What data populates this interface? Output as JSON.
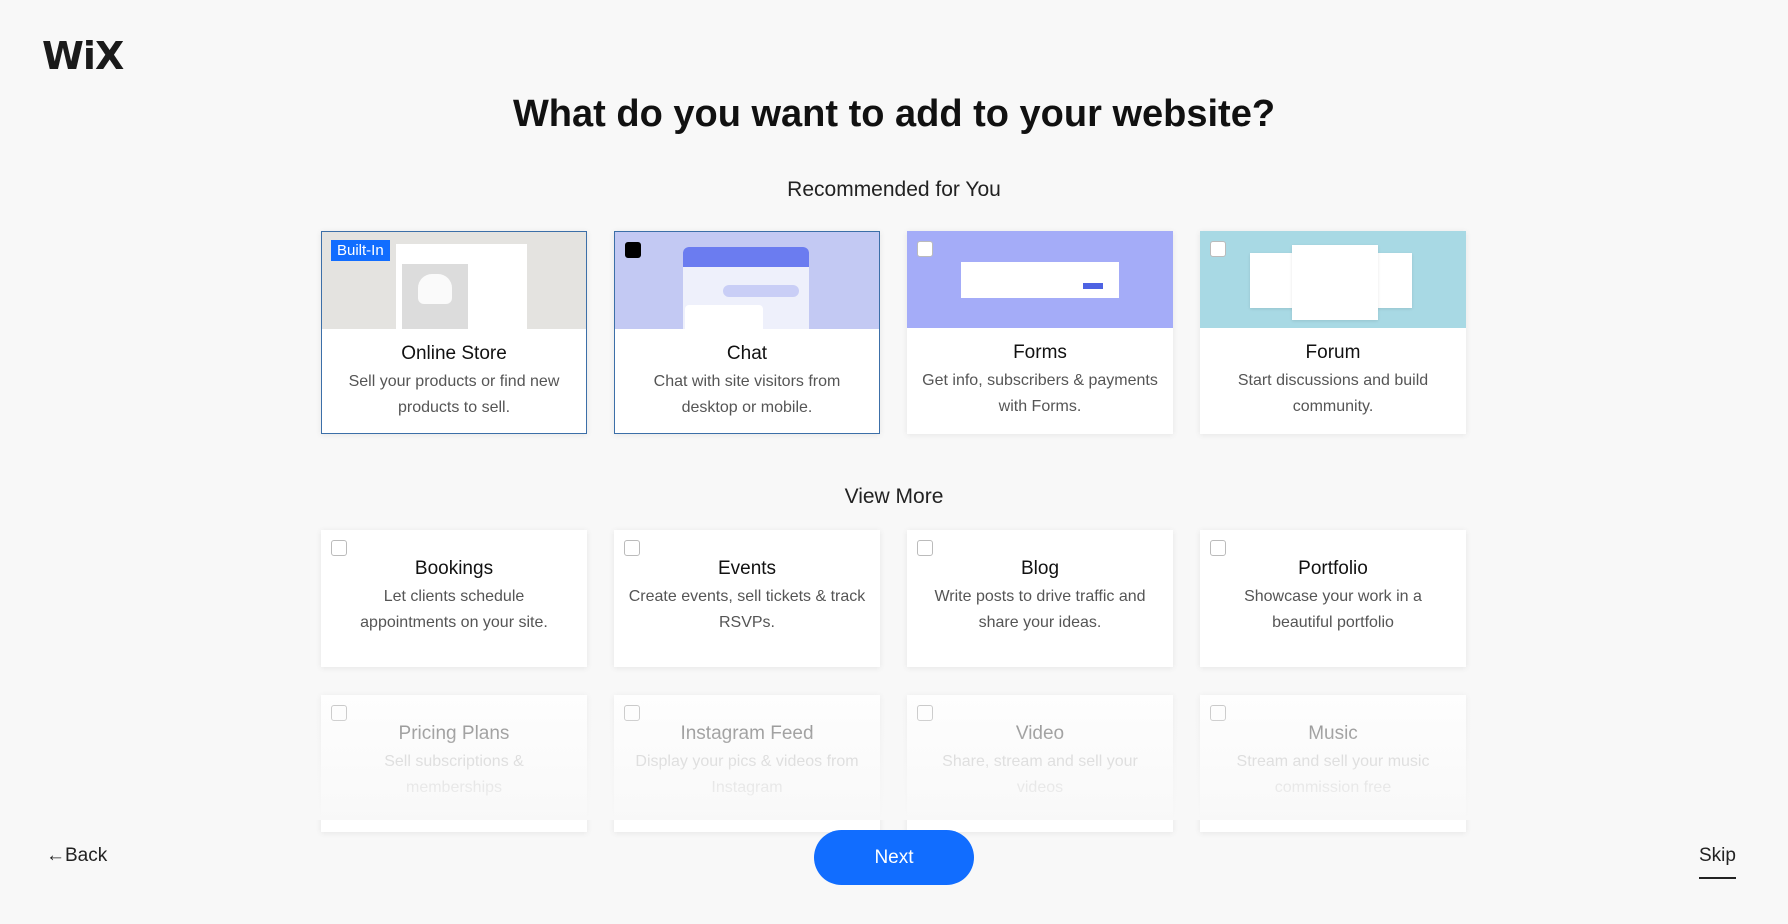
{
  "brand": {
    "logo": "WiX",
    "accent": "#116dff"
  },
  "title": "What do you want to add to your website?",
  "recommended": {
    "label": "Recommended for You",
    "items": [
      {
        "name": "Online Store",
        "desc": "Sell your products or find new products to sell.",
        "badge": "Built-In",
        "selected": true,
        "checked": false
      },
      {
        "name": "Chat",
        "desc": "Chat with site visitors from desktop or mobile.",
        "selected": true,
        "checked": true
      },
      {
        "name": "Forms",
        "desc": "Get info, subscribers & payments with Forms.",
        "selected": false,
        "checked": false
      },
      {
        "name": "Forum",
        "desc": "Start discussions and build community.",
        "selected": false,
        "checked": false
      }
    ]
  },
  "more": {
    "label": "View More",
    "items": [
      {
        "name": "Bookings",
        "desc": "Let clients schedule appointments on your site.",
        "checked": false
      },
      {
        "name": "Events",
        "desc": "Create events, sell tickets & track RSVPs.",
        "checked": false
      },
      {
        "name": "Blog",
        "desc": "Write posts to drive traffic and share your ideas.",
        "checked": false
      },
      {
        "name": "Portfolio",
        "desc": "Showcase your work in a beautiful portfolio",
        "checked": false
      },
      {
        "name": "Pricing Plans",
        "desc": "Sell subscriptions & memberships",
        "checked": false
      },
      {
        "name": "Instagram Feed",
        "desc": "Display your pics & videos from Instagram",
        "checked": false
      },
      {
        "name": "Video",
        "desc": "Share, stream and sell your videos",
        "checked": false
      },
      {
        "name": "Music",
        "desc": "Stream and sell your music commission free",
        "checked": false
      }
    ]
  },
  "footer": {
    "back": "←Back",
    "next": "Next",
    "skip": "Skip"
  }
}
